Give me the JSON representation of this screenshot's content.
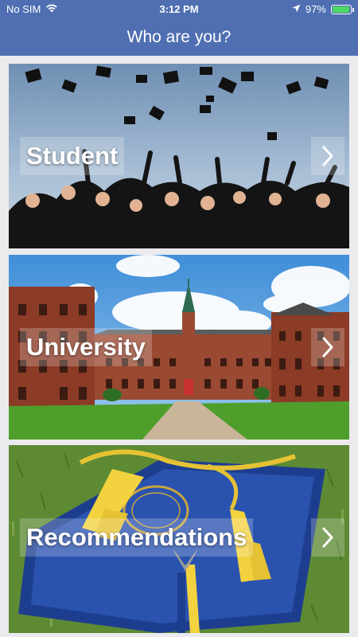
{
  "status_bar": {
    "carrier": "No SIM",
    "time": "3:12 PM",
    "battery_percent": "97%",
    "battery_level": 0.97,
    "icons": [
      "wifi-icon",
      "location-arrow-icon",
      "battery-icon"
    ]
  },
  "header": {
    "title": "Who are you?"
  },
  "cards": [
    {
      "label": "Student",
      "image": "graduates-throwing-caps"
    },
    {
      "label": "University",
      "image": "university-campus-building"
    },
    {
      "label": "Recommendations",
      "image": "diploma-with-gold-tassel"
    }
  ],
  "colors": {
    "header_bg": "#4f6fb2",
    "page_bg": "#ebebee",
    "battery": "#4cd964"
  }
}
